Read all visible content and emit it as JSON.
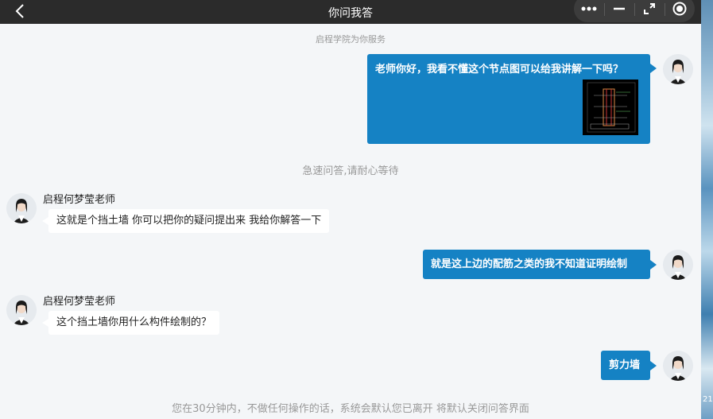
{
  "titlebar": {
    "title": "你问我答"
  },
  "system": {
    "service_note": "启程学院为你服务",
    "waiting_note": "急速问答,请耐心等待",
    "timeout_note": "您在30分钟内，不做任何操作的话，系统会默认您已离开 将默认关闭问答界面"
  },
  "messages": {
    "m1": {
      "text": "老师你好，我看不懂这个节点图可以给我讲解一下吗？"
    },
    "m2": {
      "sender": "启程何梦莹老师",
      "text": "这就是个挡土墙 你可以把你的疑问提出来 我给你解答一下"
    },
    "m3": {
      "text": "就是这上边的配筋之类的我不知道证明绘制"
    },
    "m4": {
      "sender": "启程何梦莹老师",
      "text": "这个挡土墙你用什么构件绘制的？"
    },
    "m5": {
      "text": "剪力墙"
    }
  },
  "side": {
    "text": "21"
  },
  "colors": {
    "accent": "#1582c4",
    "titlebar": "#2b2b2b",
    "background": "#f4f6f8"
  },
  "icons": [
    "back-arrow-icon",
    "more-dots-icon",
    "minimize-icon",
    "restore-icon",
    "record-icon",
    "avatar-icon",
    "drawing-thumbnail"
  ]
}
